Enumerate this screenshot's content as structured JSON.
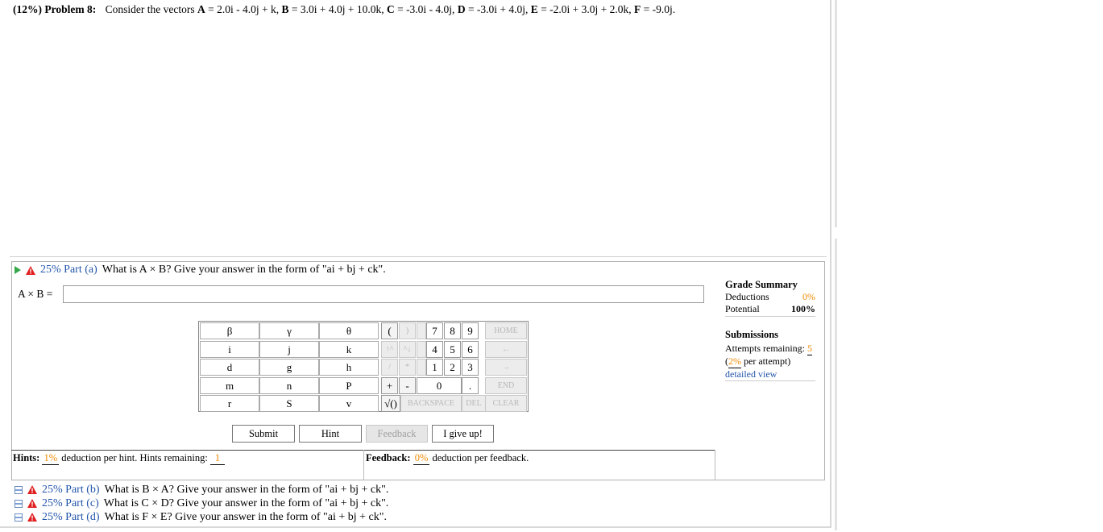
{
  "problem": {
    "prefix": "(12%)",
    "label": "Problem 8:",
    "statement_start": "Consider the vectors",
    "vectors": [
      {
        "name": "A",
        "value": " = 2.0i - 4.0j + k, "
      },
      {
        "name": "B",
        "value": " = 3.0i + 4.0j + 10.0k, "
      },
      {
        "name": "C",
        "value": " = -3.0i - 4.0j, "
      },
      {
        "name": "D",
        "value": " = -3.0i + 4.0j, "
      },
      {
        "name": "E",
        "value": " = -2.0i + 3.0j + 2.0k, "
      },
      {
        "name": "F",
        "value": " = -9.0j."
      }
    ]
  },
  "part_a": {
    "percent": "25%",
    "part": "Part (a)",
    "question": "What is A × B? Give your answer in the form of \"ai + bj + ck\".",
    "answer_label": "A × B =",
    "answer_value": ""
  },
  "keypad": {
    "vars": [
      [
        "β",
        "γ",
        "θ"
      ],
      [
        "i",
        "j",
        "k"
      ],
      [
        "d",
        "g",
        "h"
      ],
      [
        "m",
        "n",
        "P"
      ],
      [
        "r",
        "S",
        "v"
      ]
    ],
    "row1_ops": [
      "(",
      ")"
    ],
    "row2_ops": [
      "↑^",
      "^↓"
    ],
    "row3_ops": [
      "/",
      "*"
    ],
    "row4_ops": [
      "+",
      "-"
    ],
    "row5_ops": [
      "√()"
    ],
    "nums": [
      [
        "7",
        "8",
        "9"
      ],
      [
        "4",
        "5",
        "6"
      ],
      [
        "1",
        "2",
        "3"
      ]
    ],
    "zero": "0",
    "dot": ".",
    "home": "HOME",
    "left": "←",
    "right": "→",
    "end": "END",
    "backspace": "BACKSPACE",
    "del": "DEL",
    "clear": "CLEAR"
  },
  "buttons": {
    "submit": "Submit",
    "hint": "Hint",
    "feedback": "Feedback",
    "give_up": "I give up!"
  },
  "hints": {
    "label": "Hints:",
    "deduction": "1%",
    "text1": "deduction per hint. Hints remaining:",
    "remaining": "1"
  },
  "feedback": {
    "label": "Feedback:",
    "deduction": "0%",
    "text": "deduction per feedback."
  },
  "grade_summary": {
    "title": "Grade Summary",
    "deductions_label": "Deductions",
    "deductions_value": "0%",
    "potential_label": "Potential",
    "potential_value": "100%"
  },
  "submissions": {
    "title": "Submissions",
    "attempts_label": "Attempts remaining:",
    "attempts_value": "5",
    "per_attempt_open": "(",
    "per_attempt_value": "2%",
    "per_attempt_text": " per attempt)",
    "detailed_view": "detailed view"
  },
  "other_parts": [
    {
      "percent": "25%",
      "part": "Part (b)",
      "question": "What is B × A? Give your answer in the form of \"ai + bj + ck\"."
    },
    {
      "percent": "25%",
      "part": "Part (c)",
      "question": "What is C × D? Give your answer in the form of \"ai + bj + ck\"."
    },
    {
      "percent": "25%",
      "part": "Part (d)",
      "question": "What is F × E? Give your answer in the form of \"ai + bj + ck\"."
    }
  ]
}
